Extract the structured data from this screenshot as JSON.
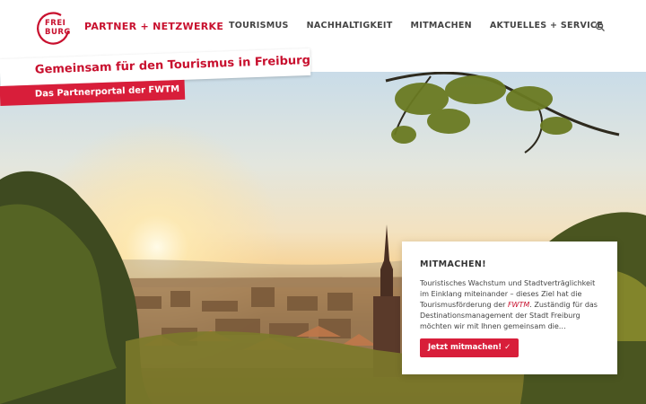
{
  "header": {
    "logo_text_1": "FREI",
    "logo_text_2": "BURG",
    "brand": "PARTNER + NETZWERKE",
    "nav": [
      "TOURISMUS",
      "NACHHALTIGKEIT",
      "MITMACHEN",
      "AKTUELLES + SERVICE"
    ],
    "search_icon": "search-icon"
  },
  "hero": {
    "title": "Gemeinsam für den Tourismus in Freiburg",
    "subtitle": "Das Partnerportal der FWTM"
  },
  "card": {
    "heading": "MITMACHEN!",
    "body_before": "Touristisches Wachstum und Stadtverträglichkeit im Einklang miteinander – dieses Ziel hat die Tourismusförderung der ",
    "body_em": "FWTM",
    "body_after": ". Zuständig für das Destinationsmanagement der Stadt Freiburg möchten wir mit Ihnen gemeinsam die…",
    "button": "Jetzt mitmachen! ✓"
  },
  "colors": {
    "brand_red": "#c8102e",
    "accent_red": "#d81e3a",
    "nav_text": "#444444"
  }
}
